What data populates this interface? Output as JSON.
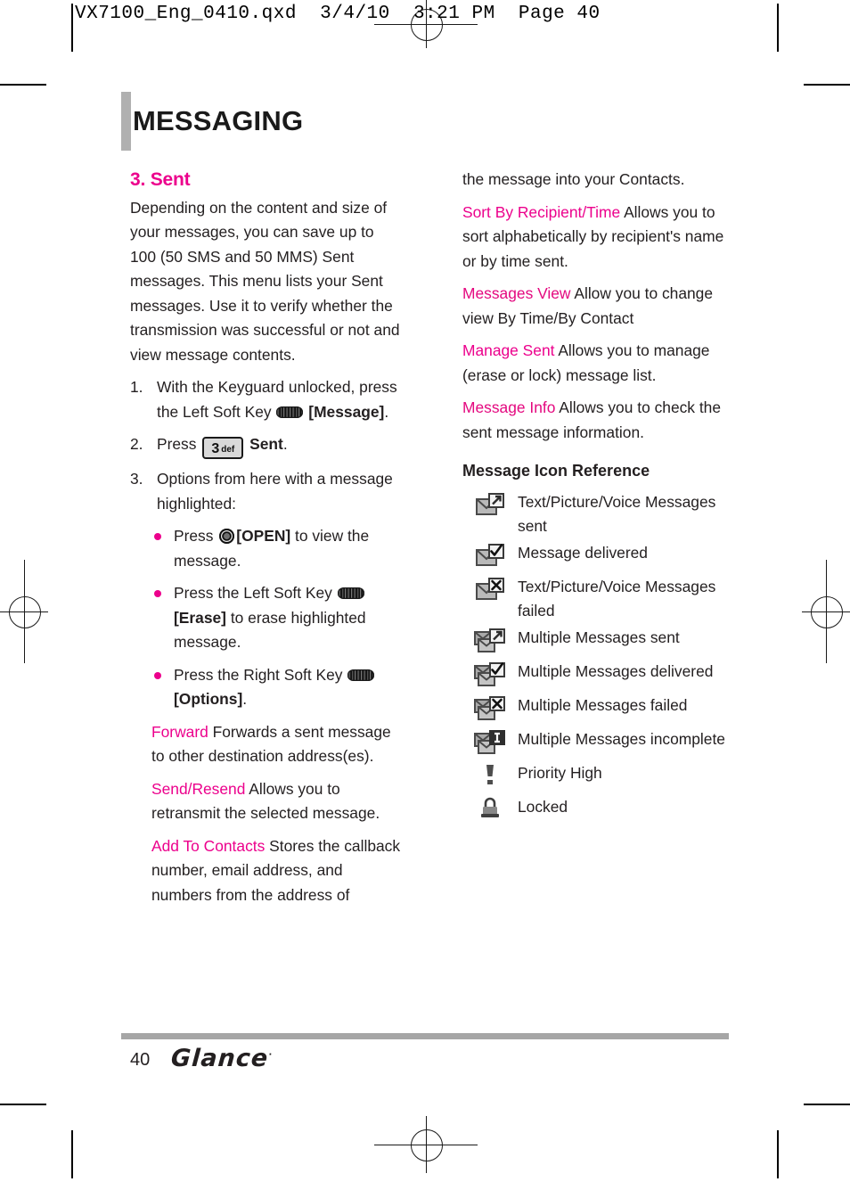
{
  "file_header": "VX7100_Eng_0410.qxd  3/4/10  3:21 PM  Page 40",
  "page": {
    "title": "MESSAGING",
    "accent_color": "#EC008C",
    "gray_color": "#A6A6A6"
  },
  "left_column": {
    "section_heading": "3. Sent",
    "intro": "Depending on the content and size of your messages, you can save up to 100 (50 SMS and 50 MMS) Sent messages. This menu lists your Sent messages. Use it to verify whether the transmission was successful or not and view message contents.",
    "steps": [
      {
        "num": "1.",
        "parts": [
          {
            "type": "text",
            "value": "With the Keyguard unlocked, press the Left Soft Key "
          },
          {
            "type": "icon",
            "value": "soft-key-icon"
          },
          {
            "type": "bold",
            "value": " [Message]"
          },
          {
            "type": "text",
            "value": "."
          }
        ],
        "text_a": "With the Keyguard unlocked, press the Left Soft Key",
        "text_b": "[Message]",
        "text_c": "."
      },
      {
        "num": "2.",
        "text_a": "Press",
        "key_digit": "3",
        "key_letters": "def",
        "text_b": "Sent",
        "text_c": "."
      },
      {
        "num": "3.",
        "text_a": "Options from here with a message highlighted:"
      }
    ],
    "bullets": [
      {
        "pre": "Press",
        "icon": "ok-key-icon",
        "bold": "[OPEN]",
        "post": "to view the message."
      },
      {
        "pre": "Press the Left Soft Key",
        "icon": "soft-key-icon",
        "bold": "[Erase]",
        "post": "to erase highlighted message."
      },
      {
        "pre": "Press the Right Soft Key",
        "icon": "soft-key-icon",
        "bold": "[Options]",
        "post": "."
      }
    ],
    "definitions": [
      {
        "term": "Forward",
        "desc": "Forwards a sent message to other destination address(es)."
      },
      {
        "term": "Send/Resend",
        "desc": "Allows you to retransmit the selected message."
      },
      {
        "term": "Add To Contacts",
        "desc": "Stores the callback number, email address, and numbers from the address of"
      }
    ]
  },
  "right_column": {
    "continuation": "the message into your Contacts.",
    "definitions": [
      {
        "term": "Sort By Recipient/Time",
        "desc": "Allows you to sort alphabetically by recipient's name or by time sent."
      },
      {
        "term": "Messages View",
        "desc": "Allow you to change view By Time/By Contact"
      },
      {
        "term": "Manage Sent",
        "desc": "Allows you to manage (erase or lock) message list."
      },
      {
        "term": "Message Info",
        "desc": "Allows you to check the sent message information."
      }
    ],
    "icon_reference": {
      "heading": "Message Icon Reference",
      "rows": [
        {
          "icon": "envelope-sent-icon",
          "label": "Text/Picture/Voice Messages sent"
        },
        {
          "icon": "envelope-delivered-icon",
          "label": "Message delivered"
        },
        {
          "icon": "envelope-failed-icon",
          "label": "Text/Picture/Voice Messages failed"
        },
        {
          "icon": "multi-envelope-sent-icon",
          "label": "Multiple Messages sent"
        },
        {
          "icon": "multi-envelope-delivered-icon",
          "label": "Multiple Messages delivered"
        },
        {
          "icon": "multi-envelope-failed-icon",
          "label": "Multiple Messages failed"
        },
        {
          "icon": "multi-envelope-incomplete-icon",
          "label": "Multiple Messages incomplete"
        },
        {
          "icon": "priority-high-icon",
          "label": "Priority High"
        },
        {
          "icon": "locked-icon",
          "label": "Locked"
        }
      ]
    }
  },
  "footer": {
    "page_number": "40",
    "brand": "Glance",
    "brand_mark": "·"
  }
}
